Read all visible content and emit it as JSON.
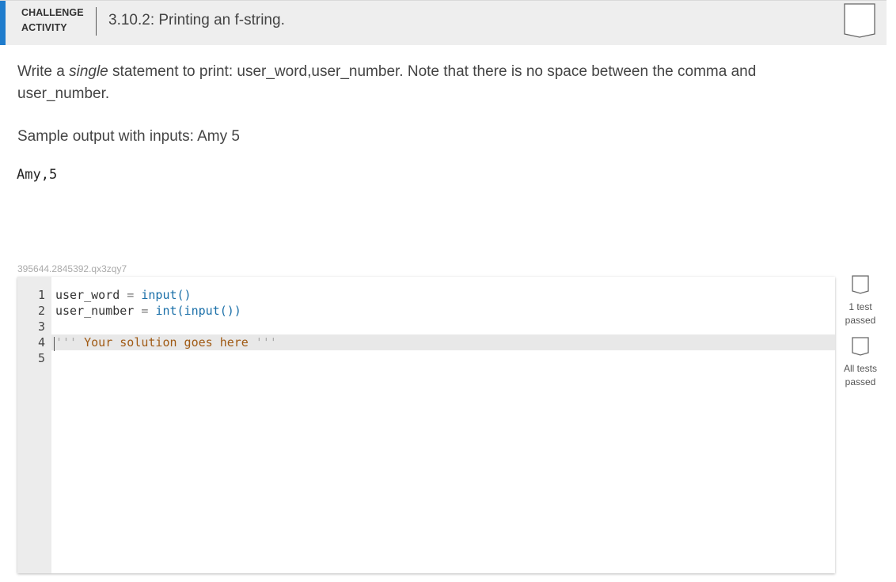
{
  "header": {
    "badge_line1": "CHALLENGE",
    "badge_line2": "ACTIVITY",
    "title": "3.10.2: Printing an f-string."
  },
  "description": {
    "line1_prefix": "Write a ",
    "line1_italic": "single",
    "line1_suffix": " statement to print: user_word,user_number. Note that there is no space between the comma and",
    "line2": "user_number."
  },
  "sample": {
    "label": "Sample output with inputs: Amy 5",
    "output": "Amy,5"
  },
  "code_id": "395644.2845392.qx3zqy7",
  "editor": {
    "line_numbers": [
      "1",
      "2",
      "3",
      "4",
      "5"
    ],
    "line1": {
      "var": "user_word",
      "op": " = ",
      "call": "input()"
    },
    "line2": {
      "var": "user_number",
      "op": " = ",
      "call": "int(input())"
    },
    "line4": {
      "open": "'''",
      "comment": " Your solution goes here ",
      "close": "'''"
    }
  },
  "status": {
    "test1_line1": "1 test",
    "test1_line2": "passed",
    "all_line1": "All tests",
    "all_line2": "passed"
  },
  "colors": {
    "accent": "#1f7ccc",
    "keyword": "#1a6fa8",
    "comment": "#a05a14"
  }
}
